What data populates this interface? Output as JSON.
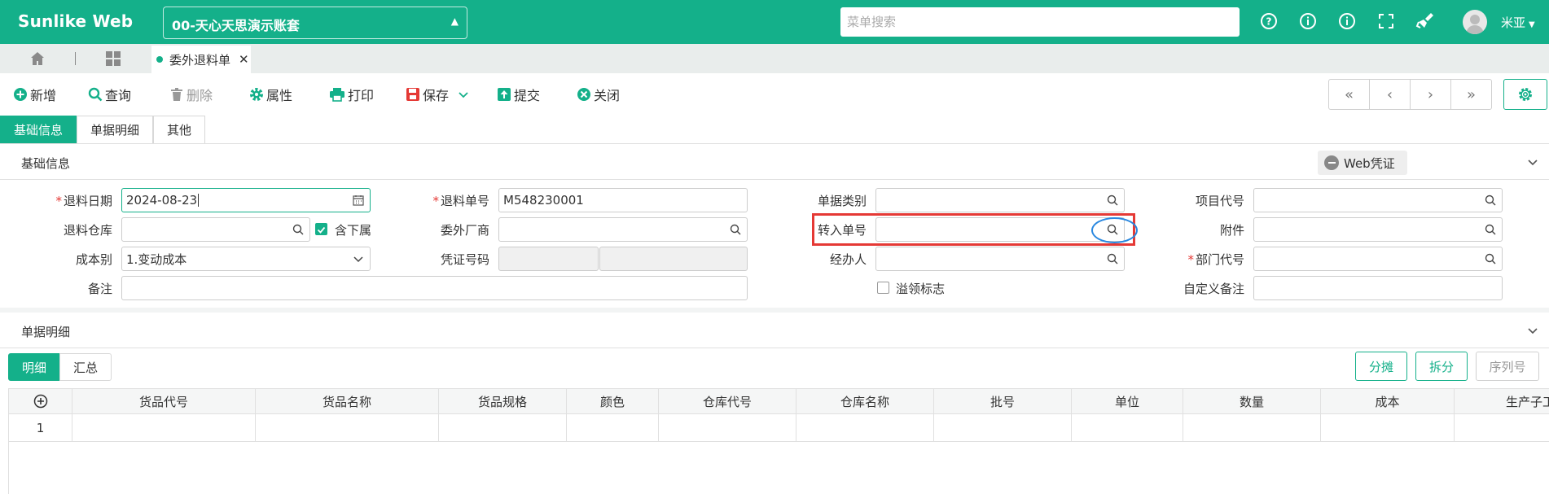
{
  "app": {
    "brand": "Sunlike Web",
    "account": "00-天心天思演示账套",
    "user": "米亚"
  },
  "search": {
    "placeholder": "菜单搜索"
  },
  "colors": {
    "primary": "#14b08a",
    "highlight_box": "#e53935",
    "highlight_ring": "#2a88e0"
  },
  "topbar_icons": [
    "help-circle-icon",
    "info-icon",
    "info-icon",
    "fullscreen-icon",
    "broom-icon",
    "user-avatar"
  ],
  "doc_tab": {
    "label": "委外退料单"
  },
  "toolbar": {
    "add": "新增",
    "query": "查询",
    "delete": "删除",
    "props": "属性",
    "print": "打印",
    "save": "保存",
    "submit": "提交",
    "close": "关闭"
  },
  "form_tabs": [
    "基础信息",
    "单据明细",
    "其他"
  ],
  "basic_section": {
    "title": "基础信息",
    "web_voucher": "Web凭证",
    "labels": {
      "return_date": "退料日期",
      "return_no": "退料单号",
      "doc_type": "单据类别",
      "project_code": "项目代号",
      "warehouse": "退料仓库",
      "include_sub": "含下属",
      "vendor": "委外厂商",
      "transfer_no": "转入单号",
      "attachment": "附件",
      "cost_type": "成本别",
      "voucher_no": "凭证号码",
      "handler": "经办人",
      "dept_code": "部门代号",
      "remark": "备注",
      "overdraw_flag": "溢领标志",
      "custom_remark": "自定义备注"
    },
    "values": {
      "return_date": "2024-08-23",
      "return_no": "M548230001",
      "cost_type": "1.变动成本"
    }
  },
  "detail_section": {
    "title": "单据明细",
    "subtabs": [
      "明细",
      "汇总"
    ],
    "buttons": {
      "allocate": "分摊",
      "split": "拆分",
      "serial": "序列号"
    },
    "columns": [
      "货品代号",
      "货品名称",
      "货品规格",
      "颜色",
      "仓库代号",
      "仓库名称",
      "批号",
      "单位",
      "数量",
      "成本",
      "生产子工"
    ],
    "rows": [
      "1"
    ]
  }
}
